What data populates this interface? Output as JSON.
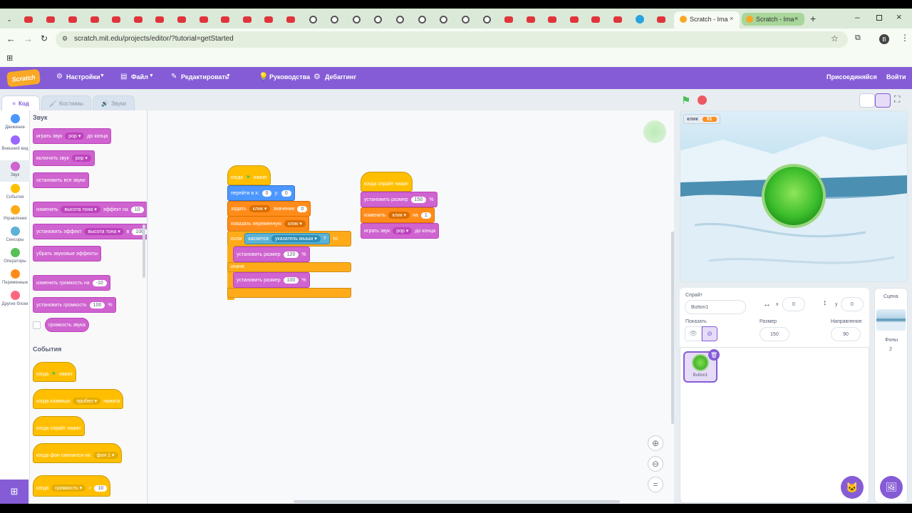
{
  "browser": {
    "tab_active_title": "Scratch - Ima",
    "tab_second_title": "Scratch - Ima",
    "url": "scratch.mit.edu/projects/editor/?tutorial=getStarted",
    "profile_initial": "B"
  },
  "menubar": {
    "logo": "Scratch",
    "settings": "Настройки",
    "file": "Файл",
    "edit": "Редактировать",
    "tutorials": "Руководства",
    "debugging": "Дебаггинг",
    "join": "Присоединяйся",
    "signin": "Войти"
  },
  "editor_tabs": {
    "code": "Код",
    "costumes": "Костюмы",
    "sounds": "Звуки"
  },
  "categories": [
    {
      "label": "Движение",
      "color": "#4c97ff"
    },
    {
      "label": "Внешний вид",
      "color": "#9966ff"
    },
    {
      "label": "Звук",
      "color": "#cf63cf"
    },
    {
      "label": "События",
      "color": "#ffbf00"
    },
    {
      "label": "Управление",
      "color": "#ffab19"
    },
    {
      "label": "Сенсоры",
      "color": "#5cb1d6"
    },
    {
      "label": "Операторы",
      "color": "#59c059"
    },
    {
      "label": "Переменные",
      "color": "#ff8c1a"
    },
    {
      "label": "Другие блоки",
      "color": "#ff6680"
    }
  ],
  "palette": {
    "sound_title": "Звук",
    "play_sound": "играть звук",
    "pop": "pop",
    "until_done": "до конца",
    "start_sound": "включить звук",
    "stop_all_sounds": "остановить все звуки",
    "change_effect": "изменить",
    "pitch": "высота тона",
    "effect_by": "эффект на",
    "effect_value": "10",
    "set_effect": "установить эффект",
    "set_to": "в",
    "set_value": "100",
    "clear_effects": "убрать звуковые эффекты",
    "change_volume": "изменить громкость на",
    "change_volume_value": "-10",
    "set_volume": "установить громкость",
    "set_volume_value": "100",
    "percent": "%",
    "volume_reporter": "громкость звука",
    "events_title": "События",
    "when": "когда",
    "clicked": "нажат",
    "when_key": "когда клавиша",
    "space": "пробел",
    "pressed": "нажата",
    "when_sprite_clicked": "когда спрайт нажат",
    "when_backdrop": "когда фон сменился на",
    "backdrop1": "фон 1",
    "when_loudness": "когда",
    "loudness": "громкость",
    "gt": ">",
    "loudness_value": "10"
  },
  "script1": {
    "hat": "когда",
    "hat2": "нажат",
    "goto": "перейти в x:",
    "x_val": "0",
    "y_lbl": "y:",
    "y_val": "0",
    "set_var": "задать",
    "var_name": "клик",
    "to_value": "значение",
    "var_val": "0",
    "show_var": "показать переменную",
    "show_var_name": "клик",
    "if": "если",
    "touching": "касается",
    "mouse_pointer": "указатель мыши",
    "q": "?",
    "then": "то",
    "set_size1": "установить размер",
    "size1": "120",
    "pct": "%",
    "else": "иначе",
    "set_size2": "установить размер",
    "size2": "100"
  },
  "script2": {
    "hat": "когда спрайт нажат",
    "set_size": "установить размер",
    "size": "150",
    "pct": "%",
    "change": "изменить",
    "var_name": "клик",
    "by": "на",
    "by_val": "1",
    "play": "играть звук",
    "sound": "pop",
    "until_done": "до конца"
  },
  "stage": {
    "monitor_label": "клик",
    "monitor_value": "81"
  },
  "sprite_info": {
    "sprite_label": "Спрайт",
    "sprite_name": "Button1",
    "x_label": "x",
    "x": "0",
    "y_label": "y",
    "y": "0",
    "show_label": "Показать",
    "size_label": "Размер",
    "size": "150",
    "direction_label": "Направление",
    "direction": "90"
  },
  "sprite_tile": {
    "name": "Button1"
  },
  "scene": {
    "title": "Сцена",
    "backdrops_label": "Фоны",
    "backdrops_count": "2"
  },
  "colors": {
    "menubar": "#855cd6",
    "accent": "#855cd6"
  }
}
